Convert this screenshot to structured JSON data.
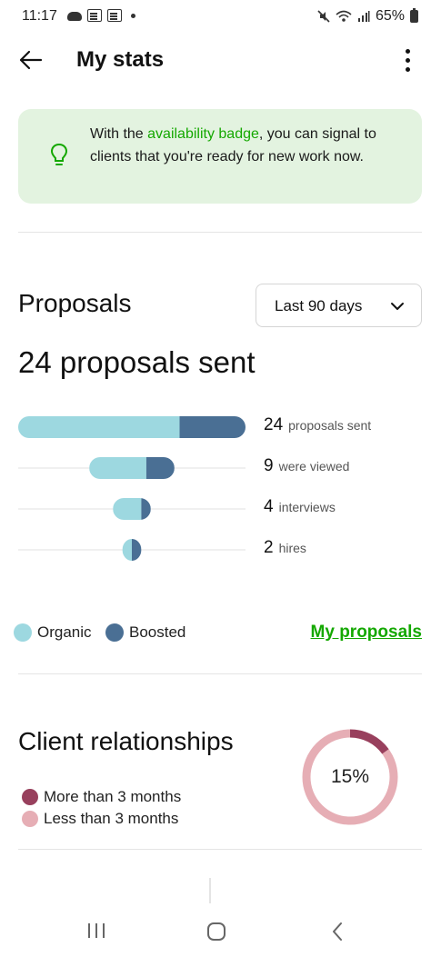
{
  "status_bar": {
    "time": "11:17",
    "battery": "65%"
  },
  "header": {
    "title": "My stats"
  },
  "banner": {
    "text_before": "With the ",
    "link": "availability badge",
    "text_after": ", you can signal to clients that you're ready for new work now."
  },
  "proposals": {
    "title": "Proposals",
    "range": "Last 90 days",
    "summary": "24 proposals sent",
    "funnel": [
      {
        "value": 24,
        "label": "proposals sent",
        "organic_fraction": 0.71
      },
      {
        "value": 9,
        "label": "were viewed",
        "organic_fraction": 0.67
      },
      {
        "value": 4,
        "label": "interviews",
        "organic_fraction": 0.75
      },
      {
        "value": 2,
        "label": "hires",
        "organic_fraction": 0.5
      }
    ],
    "legend": {
      "organic": "Organic",
      "boosted": "Boosted"
    },
    "link": "My proposals"
  },
  "client_relationships": {
    "title": "Client relationships",
    "legend_long": "More than 3 months",
    "legend_short": "Less than 3 months",
    "percent_label": "15%",
    "percent": 15
  },
  "colors": {
    "organic": "#9dd8e0",
    "boosted": "#4a6f94",
    "long": "#98405d",
    "short": "#e6aeb5",
    "accent": "#14a800",
    "banner_bg": "#e3f3e0"
  }
}
